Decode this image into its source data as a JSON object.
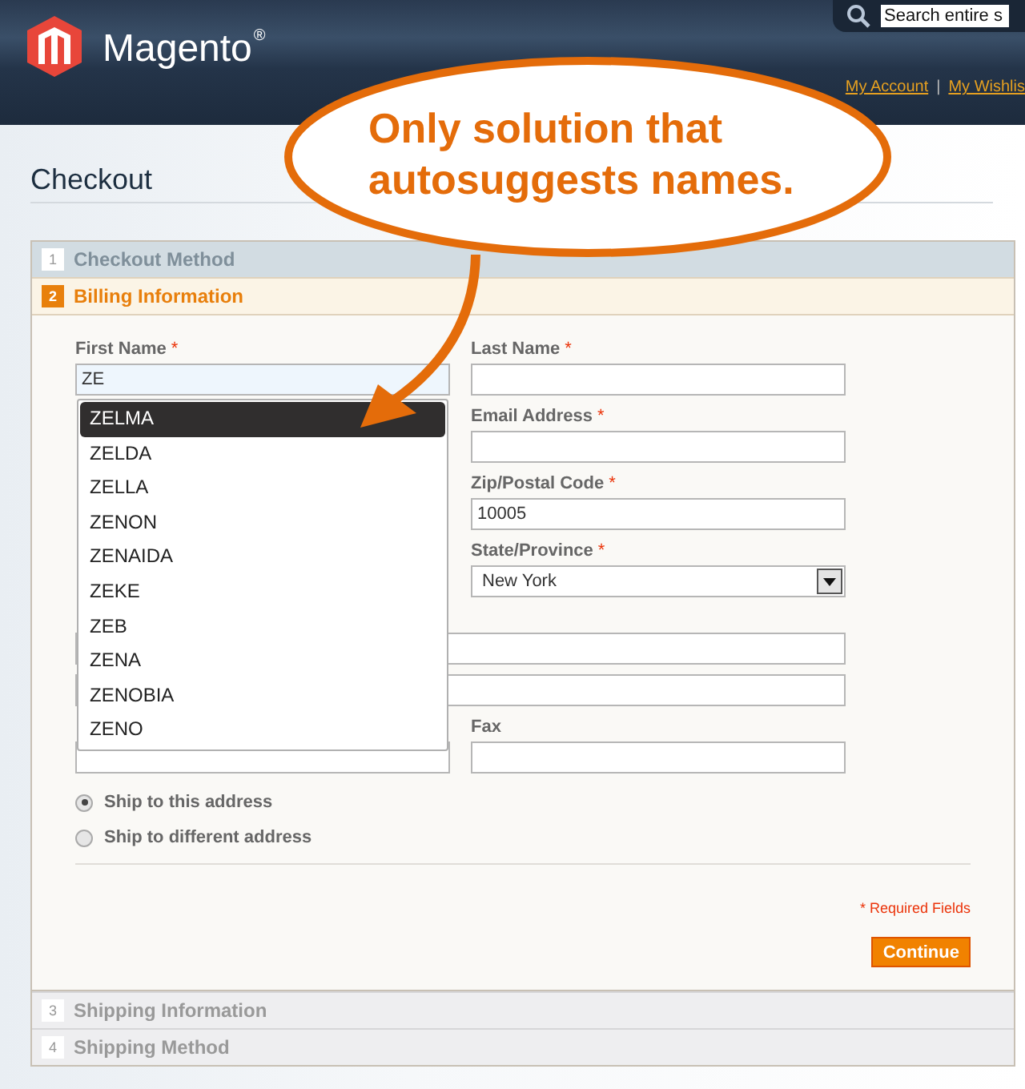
{
  "header": {
    "brand": "Magento",
    "brand_mark": "®",
    "search": {
      "placeholder": "Search entire s"
    },
    "links": [
      "My Account",
      "My Wishlis"
    ],
    "separator": "|"
  },
  "callout": {
    "lines": [
      "Only solution that",
      "autosuggests names."
    ]
  },
  "page_title": "Checkout",
  "steps_before": [
    {
      "number": "1",
      "title": "Checkout Method",
      "selected": false,
      "completed": true
    },
    {
      "number": "2",
      "title": "Billing Information",
      "selected": true,
      "completed": false
    }
  ],
  "billing": {
    "fields": [
      {
        "kind": "text",
        "label": "First Name",
        "required_mark": "*",
        "value": "ZE",
        "focused": true,
        "suggestions": [
          {
            "text": "ZELMA",
            "selected": true
          },
          {
            "text": "ZELDA",
            "selected": false
          },
          {
            "text": "ZELLA",
            "selected": false
          },
          {
            "text": "ZENON",
            "selected": false
          },
          {
            "text": "ZENAIDA",
            "selected": false
          },
          {
            "text": "ZEKE",
            "selected": false
          },
          {
            "text": "ZEB",
            "selected": false
          },
          {
            "text": "ZENA",
            "selected": false
          },
          {
            "text": "ZENOBIA",
            "selected": false
          },
          {
            "text": "ZENO",
            "selected": false
          }
        ]
      },
      {
        "kind": "text",
        "label": "Last Name",
        "required_mark": "*"
      },
      {
        "kind": "text",
        "label": "Email Address",
        "required_mark": "*"
      },
      {
        "kind": "text",
        "label": "Zip/Postal Code",
        "required_mark": "*",
        "value": "10005"
      },
      {
        "kind": "select",
        "label": "State/Province",
        "required_mark": "*",
        "value": "New York"
      },
      {
        "kind": "twoline"
      },
      {
        "kind": "text"
      },
      {
        "kind": "text",
        "label": "Fax"
      }
    ],
    "radios": [
      {
        "label": "Ship to this address",
        "selected": true
      },
      {
        "label": "Ship to different address",
        "selected": false
      }
    ],
    "required_note": "* Required Fields",
    "button": "Continue"
  },
  "steps_after": [
    {
      "number": "3",
      "title": "Shipping Information",
      "selected": false,
      "completed": false
    },
    {
      "number": "4",
      "title": "Shipping Method",
      "selected": false,
      "completed": false
    }
  ]
}
